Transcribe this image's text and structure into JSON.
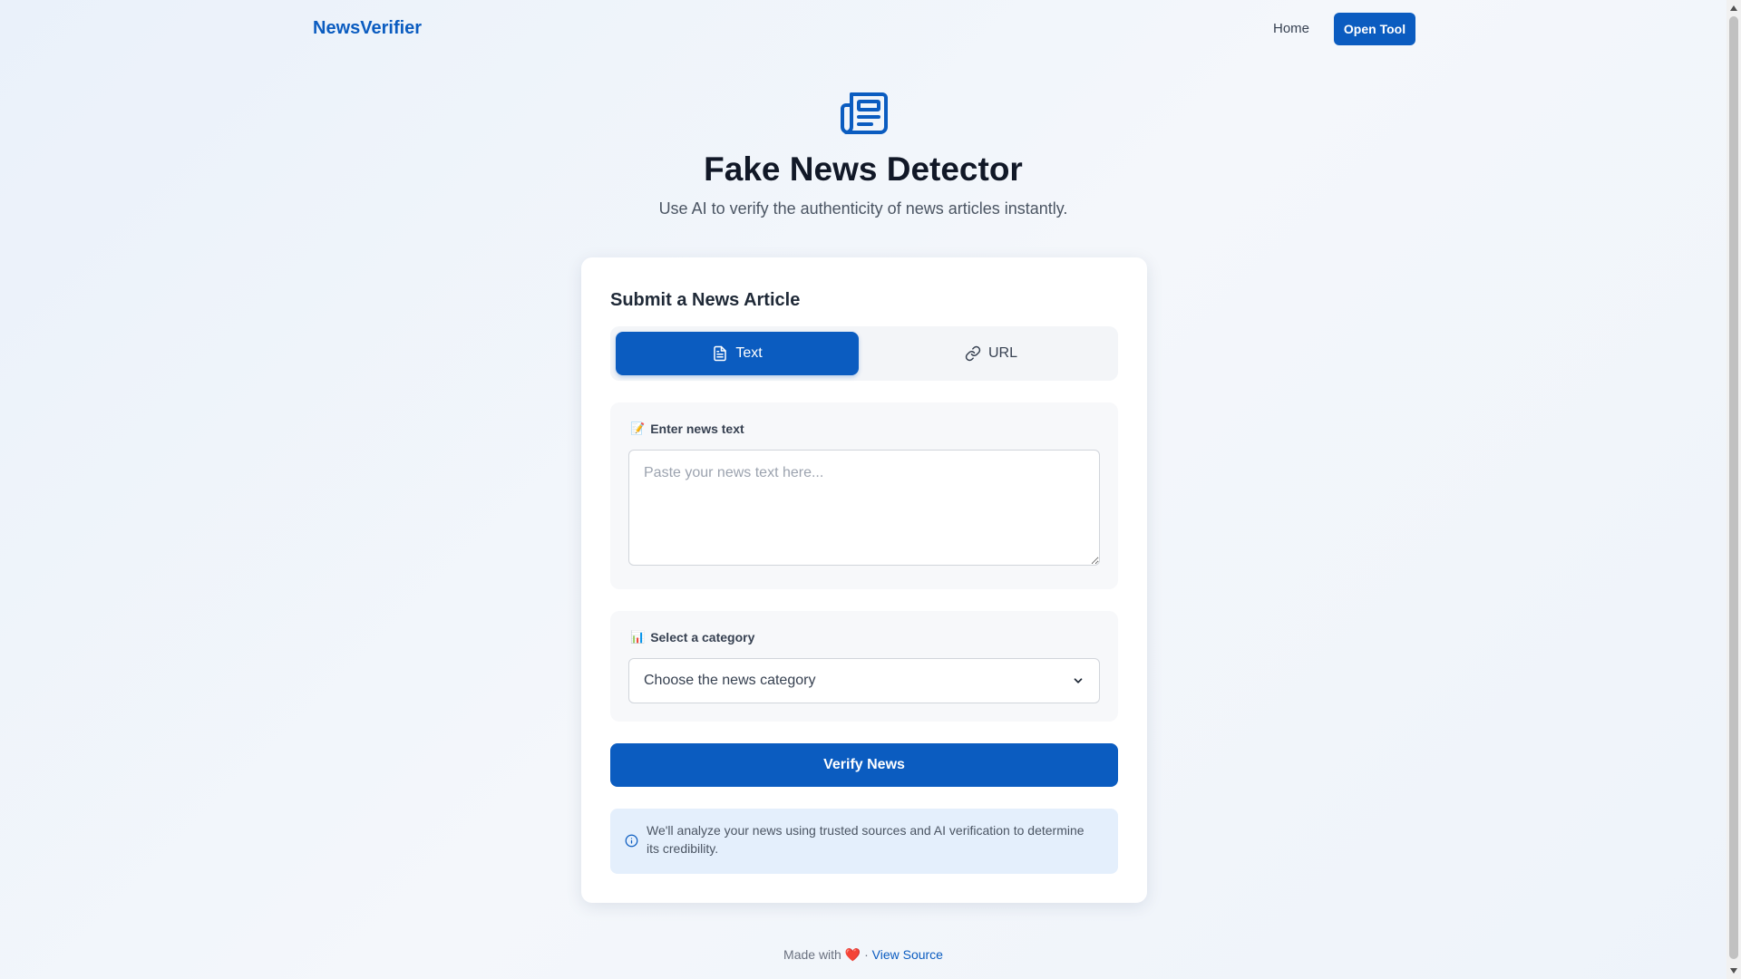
{
  "nav": {
    "brand": "NewsVerifier",
    "home_label": "Home",
    "open_tool_label": "Open Tool"
  },
  "hero": {
    "icon": "newspaper-icon",
    "title": "Fake News Detector",
    "subtitle": "Use AI to verify the authenticity of news articles instantly."
  },
  "form": {
    "title": "Submit a News Article",
    "tabs": [
      {
        "label": "Text",
        "icon": "document-icon",
        "active": true
      },
      {
        "label": "URL",
        "icon": "link-icon",
        "active": false
      }
    ],
    "text_section": {
      "emoji": "📝",
      "label": "Enter news text",
      "placeholder": "Paste your news text here...",
      "value": ""
    },
    "category_section": {
      "emoji": "📊",
      "label": "Select a category",
      "selected": "Choose the news category"
    },
    "verify_label": "Verify News",
    "info": "We'll analyze your news using trusted sources and AI verification to determine its credibility."
  },
  "footer": {
    "made_with": "Made with",
    "heart": "❤️",
    "separator": "·",
    "source_label": "View Source"
  },
  "colors": {
    "primary": "#0b5cc0",
    "info_bg": "#e4effc"
  }
}
